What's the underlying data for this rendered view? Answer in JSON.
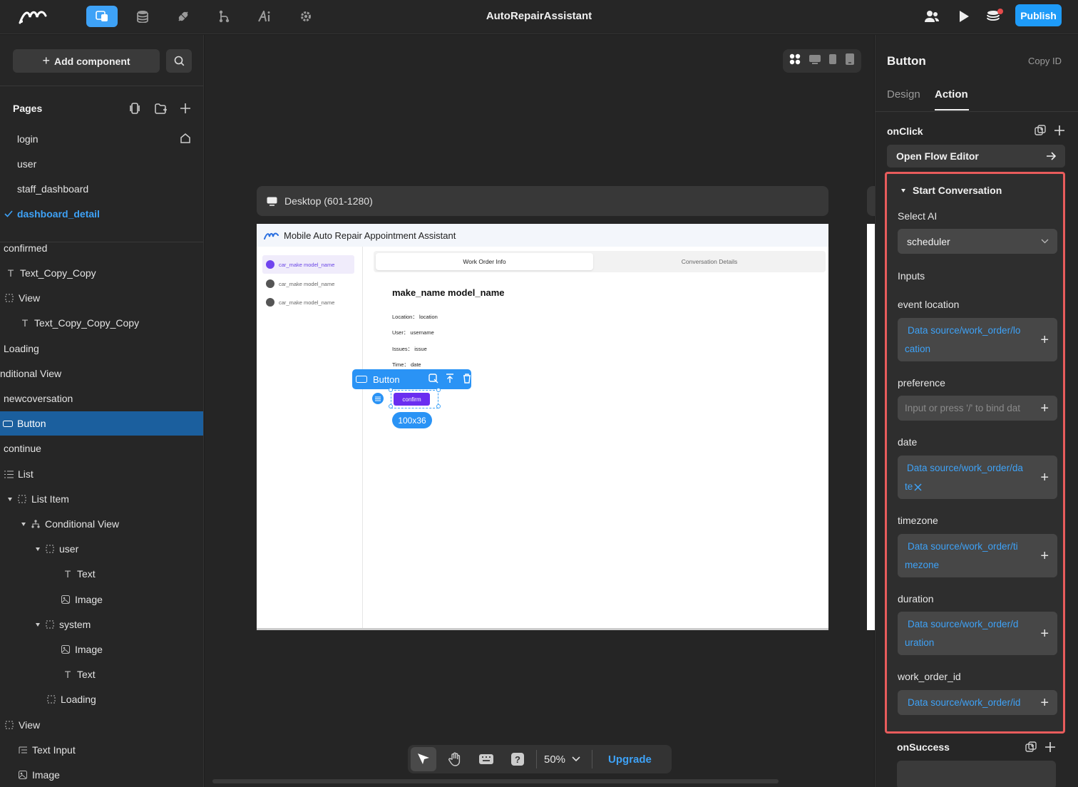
{
  "topbar": {
    "title": "AutoRepairAssistant",
    "publish_label": "Publish",
    "icons": [
      "logo-icon",
      "pages-icon",
      "database-icon",
      "plugin-icon",
      "workflow-icon",
      "ai-icon",
      "settings-icon",
      "users-icon",
      "play-icon",
      "notifications-icon"
    ]
  },
  "left": {
    "add_component": "Add component",
    "pages_title": "Pages",
    "pages": [
      "login",
      "user",
      "staff_dashboard",
      "dashboard_detail"
    ],
    "tree": [
      "confirmed",
      "Text_Copy_Copy",
      "View",
      "Text_Copy_Copy_Copy",
      "Loading",
      "nditional View",
      "newcoversation",
      "Button",
      "continue",
      "List",
      "List Item",
      "Conditional View",
      "user",
      "Text",
      "Image",
      "system",
      "Image",
      "Text",
      "Loading",
      "View",
      "Text Input",
      "Image"
    ]
  },
  "canvas": {
    "frame_label": "Desktop (601-1280)",
    "app_header": "Mobile Auto Repair Appointment Assistant",
    "side_items": [
      "car_make model_name",
      "car_make model_name",
      "car_make model_name"
    ],
    "tabs": [
      "Work Order Info",
      "Conversation Details"
    ],
    "title": "make_name model_name",
    "fields": [
      "Location： location",
      "User： username",
      "Issues： issue",
      "Time： date"
    ],
    "selection_label": "Button",
    "button_label": "confirm",
    "size": "100x36",
    "zoom": "50%",
    "upgrade": "Upgrade"
  },
  "right": {
    "title": "Button",
    "copy_id": "Copy ID",
    "tabs": [
      "Design",
      "Action"
    ],
    "active_tab": "Action",
    "onclick": "onClick",
    "open_flow": "Open Flow Editor",
    "action_title": "Start Conversation",
    "select_ai_label": "Select AI",
    "select_ai_value": "scheduler",
    "inputs_label": "Inputs",
    "inputs": [
      {
        "label": "event location",
        "lines": [
          "Data source/work_order/lo",
          "cation"
        ]
      },
      {
        "label": "preference",
        "placeholder": "Input or press '/' to bind dat"
      },
      {
        "label": "date",
        "lines": [
          "Data source/work_order/da",
          "te"
        ]
      },
      {
        "label": "timezone",
        "lines": [
          "Data source/work_order/ti",
          "mezone"
        ]
      },
      {
        "label": "duration",
        "lines": [
          "Data source/work_order/d",
          "uration"
        ]
      },
      {
        "label": "work_order_id",
        "lines": [
          "Data source/work_order/id"
        ]
      }
    ],
    "onsuccess": "onSuccess"
  },
  "colors": {
    "accent": "#3ea2f7",
    "selected_row": "#1b5f9e",
    "highlight_border": "#e85c5c",
    "button_purple": "#6a2ef0"
  }
}
